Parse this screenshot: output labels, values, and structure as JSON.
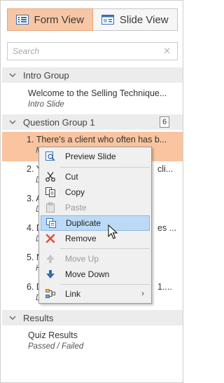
{
  "view_tabs": [
    {
      "label": "Form View",
      "icon": "form-view-icon",
      "active": true
    },
    {
      "label": "Slide View",
      "icon": "slide-view-icon",
      "active": false
    }
  ],
  "search": {
    "placeholder": "Search",
    "value": ""
  },
  "groups": {
    "intro": {
      "title": "Intro Group"
    },
    "question": {
      "title": "Question Group 1",
      "count": "6"
    },
    "results": {
      "title": "Results"
    }
  },
  "slides": {
    "welcome": {
      "title": "Welcome to the Selling Technique...",
      "subtitle": "Intro Slide"
    },
    "q1": {
      "num": "1.",
      "title": "There's a client who often has b...",
      "subtitle": "M"
    },
    "q2": {
      "num": "2.",
      "title": "Y",
      "title_tail": "cli...",
      "subtitle": "D"
    },
    "q3": {
      "num": "3.",
      "title": "A",
      "subtitle": "D"
    },
    "q4": {
      "num": "4.",
      "title": "D",
      "title_tail": "es ...",
      "subtitle": "D"
    },
    "q5": {
      "num": "5.",
      "title": "N",
      "subtitle": "H"
    },
    "q6": {
      "num": "6.",
      "title": "D",
      "title_tail": "1....",
      "subtitle": "D"
    },
    "results": {
      "title": "Quiz Results",
      "subtitle": "Passed / Failed"
    }
  },
  "context_menu": {
    "preview": "Preview Slide",
    "cut": "Cut",
    "copy": "Copy",
    "paste": "Paste",
    "duplicate": "Duplicate",
    "remove": "Remove",
    "move_up": "Move Up",
    "move_down": "Move Down",
    "link": "Link",
    "submenu_arrow": "›"
  },
  "colors": {
    "accent": "#f7c6a4",
    "selected_row": "#f9c49f",
    "menu_hover": "#bcdaf6"
  }
}
